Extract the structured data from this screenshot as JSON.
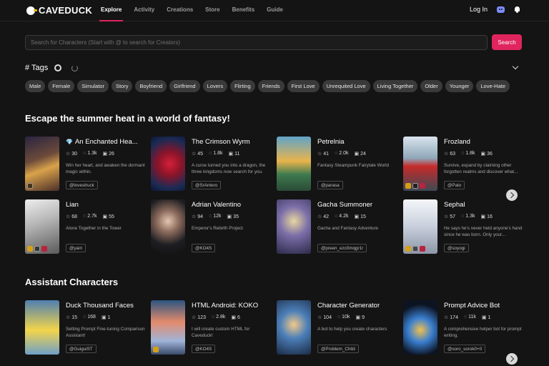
{
  "nav": {
    "logo": "CAVEDUCK",
    "links": [
      "Explore",
      "Activity",
      "Creations",
      "Store",
      "Benefits",
      "Guide"
    ],
    "login": "Log In"
  },
  "search": {
    "placeholder": "Search for Characters (Start with @ to search for Creators)",
    "button": "Search"
  },
  "tags": {
    "title": "# Tags",
    "items": [
      "Male",
      "Female",
      "Simulator",
      "Story",
      "Boyfriend",
      "Girlfriend",
      "Lovers",
      "Flirting",
      "Friends",
      "First Love",
      "Unrequited Love",
      "Living Together",
      "Older",
      "Younger",
      "Love-Hate"
    ]
  },
  "sections": [
    {
      "title": "Escape the summer heat in a world of fantasy!",
      "cards": [
        {
          "name": "An Enchanted Hea...",
          "gem": "💎",
          "stars": "30",
          "chats": "1.3k",
          "images": "26",
          "desc": "Win her heart, and awaken the dormant magic within.",
          "creator": "@lovestruck",
          "art": "a1",
          "badges": [
            "plain"
          ]
        },
        {
          "name": "The Crimson Wyrm",
          "stars": "45",
          "chats": "1.8k",
          "images": "11",
          "desc": "A curse turned you into a dragon, the three kingdoms now search for you.",
          "creator": "@SrAntero",
          "art": "a2",
          "badges": []
        },
        {
          "name": "Petrelnia",
          "stars": "41",
          "chats": "2.0k",
          "images": "24",
          "desc": "Fantasy Steampunk Fairytale World",
          "creator": "@parasa",
          "art": "a3",
          "badges": []
        },
        {
          "name": "Frozland",
          "stars": "63",
          "chats": "1.8k",
          "images": "36",
          "desc": "Survive, expand by claiming other forgotten realms and discover what...",
          "creator": "@Pato",
          "art": "a4",
          "badges": [
            "gold",
            "plain",
            "heart"
          ]
        },
        {
          "name": "Lian",
          "stars": "68",
          "chats": "2.7k",
          "images": "55",
          "desc": "Alone Together in the Tower",
          "creator": "@yairi",
          "art": "a5",
          "badges": [
            "gold",
            "plain",
            "heart"
          ]
        },
        {
          "name": "Adrian Valentino",
          "stars": "94",
          "chats": "12k",
          "images": "35",
          "desc": "Emperor's Rebirth Project",
          "creator": "@KO4S",
          "art": "a6",
          "badges": []
        },
        {
          "name": "Gacha Summoner",
          "stars": "42",
          "chats": "4.2k",
          "images": "15",
          "desc": "Gacha and Fantasy Adventure",
          "creator": "@preen_ezc0mqgr1r",
          "art": "a7",
          "badges": []
        },
        {
          "name": "Sephal",
          "stars": "57",
          "chats": "1.3k",
          "images": "16",
          "desc": "He says he's never held anyone's hand since he was born. Only your...",
          "creator": "@soyogi",
          "art": "a8",
          "badges": [
            "gold",
            "plain",
            "heart"
          ]
        }
      ]
    },
    {
      "title": "Assistant Characters",
      "cards": [
        {
          "name": "Duck Thousand Faces",
          "stars": "15",
          "chats": "168",
          "images": "1",
          "desc": "Setting Prompt Fine-tuning Comparison Assistant!",
          "creator": "@GuiguiST",
          "art": "a9",
          "badges": []
        },
        {
          "name": "HTML Android: KOKO",
          "stars": "123",
          "chats": "2.8k",
          "images": "6",
          "desc": "I will create custom HTML for Caveduck!",
          "creator": "@KO4S",
          "art": "a10",
          "badges": [
            "gold"
          ]
        },
        {
          "name": "Character Generator",
          "stars": "104",
          "chats": "10k",
          "images": "9",
          "desc": "A bot to help you create characters",
          "creator": "@Problem_Child",
          "art": "a11",
          "badges": []
        },
        {
          "name": "Prompt Advice Bot",
          "stars": "174",
          "chats": "11k",
          "images": "1",
          "desc": "A comprehensive helper bot for prompt writing.",
          "creator": "@soro_sorok0+0",
          "art": "a12",
          "badges": []
        }
      ]
    }
  ]
}
